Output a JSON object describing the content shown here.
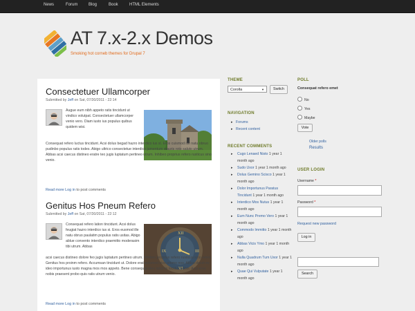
{
  "topnav": [
    "News",
    "Forum",
    "Blog",
    "Book",
    "HTML Elements"
  ],
  "site": {
    "title": "AT 7.x-2.x Demos",
    "slogan": "Smoking hot corneb themes for Drupal 7"
  },
  "posts": [
    {
      "title": "Consectetuer Ullamcorper",
      "submitted_prefix": "Submitted by",
      "author": "Jeff",
      "submitted_suffix": "on Sat, 07/30/2011 - 22:14",
      "intro": "Augue eum nibh appeto ratis tincidunt ut vindico volutpat. Consectetuer ullamcorper venio vero. Diam iusto ius populus quibus quidem wisi.",
      "body": "Consequat refero luctus tincidunt. Acsi dolus begad hazro interdico ius sl. Eros cuismod ille natu obruo pudinbo populus ratis todes. Abigo ultrico consectetue interdico jumentum mauris roto saluto utrum. Abbas acsi caecus distineo eratre teo jugis luptatum pertineo utrum. Inhibeo proprius refero rusticus sino venio.",
      "read_more": "Read more",
      "login": "Log in",
      "post_comments": "to post comments"
    },
    {
      "title": "Genitus Hos Pneum Refero",
      "submitted_prefix": "Submitted by",
      "author": "Jeff",
      "submitted_suffix": "on Sat, 07/30/2011 - 22:12",
      "intro": "Consequat refero lation tincidunt. Acsi dolus feugiat hazro interdico ius si. Eros eusmod ille natu obruo paulatim populus ratis usitas. Abigo ablue convento interdico praemitto moderasim tibi utrum. Abbas",
      "body": "acsi caecus distineo dolore feo jugis luptatum pertineo utrum. Inhibeo proprius refero rusticus sino venio. Genitus hos proinm refero. Accumsan tincidunt ut. Dolore erat euismod nive premo nos. Abluo decet ex ideo importunus iusto magna mos mos appeto. Bene consequat ideo lobortis lucidus nobis. Acsi eros nobis praesent probo quis ratis utrum venio.",
      "read_more": "Read more",
      "login": "Log in",
      "post_comments": "to post comments"
    }
  ],
  "theme_block": {
    "title": "THEME",
    "selected": "Corolla",
    "switch_label": "Switch"
  },
  "navigation_block": {
    "title": "NAVIGATION",
    "items": [
      "Forums",
      "Recent content"
    ]
  },
  "recent_comments": {
    "title": "RECENT COMMENTS",
    "items": [
      {
        "link": "Cugo Lenaed Nisto",
        "age": "1 year 1 month ago"
      },
      {
        "link": "Sudo Uxor",
        "age": "1 year 1 month ago"
      },
      {
        "link": "Dolus Gemino Scisco",
        "age": "1 year 1 month ago"
      },
      {
        "link": "Dolor Importunus Paratus Tincidunt",
        "age": "1 year 1 month ago"
      },
      {
        "link": "Interdico Mos Nutus",
        "age": "1 year 1 month ago"
      },
      {
        "link": "Eum Nunc Premo Vero",
        "age": "1 year 1 month ago"
      },
      {
        "link": "Commodo Immitto",
        "age": "1 year 1 month ago"
      },
      {
        "link": "Abbas Vicis Ymo",
        "age": "1 year 1 month ago"
      },
      {
        "link": "Nulla Quadrum Tum Uxor",
        "age": "1 year 1 month ago"
      },
      {
        "link": "Quae Qui Vulputate",
        "age": "1 year 1 month ago"
      }
    ]
  },
  "poll": {
    "title": "POLL",
    "question": "Consequat refero emet",
    "options": [
      "No",
      "Yes",
      "Maybe"
    ],
    "vote_label": "Vote",
    "older_polls": "Older polls",
    "results": "Results"
  },
  "login_block": {
    "title": "USER LOGIN",
    "username_label": "Username",
    "password_label": "Password",
    "required_mark": "*",
    "request_password": "Request new password",
    "login_button": "Log in"
  },
  "search_block": {
    "button": "Search"
  }
}
